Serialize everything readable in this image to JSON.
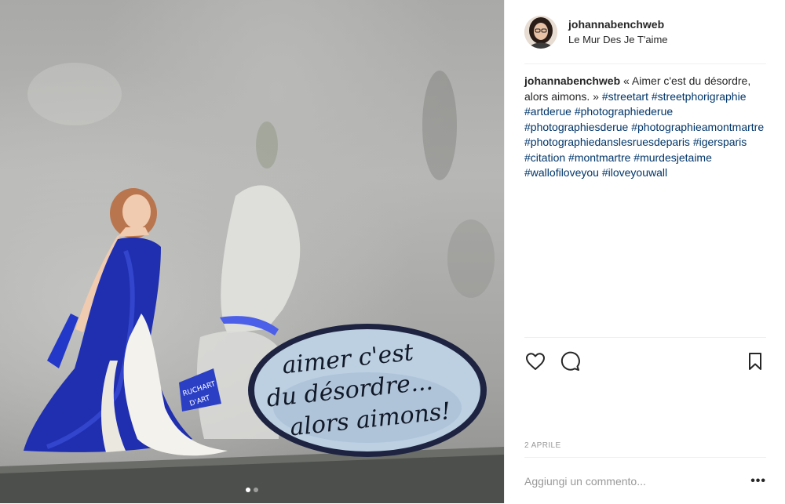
{
  "post": {
    "username": "johannabenchweb",
    "location": "Le Mur Des Je T'aime",
    "caption": {
      "username": "johannabenchweb",
      "text": "« Aimer c'est du désordre, alors aimons. »",
      "hashtags": "#streetart #streetphorigraphie #artderue #photographiederue #photographiesderue #photographieamontmartre #photographiedanslesruesdeparis #igersparis #citation #montmartre #murdesjetaime #wallofiloveyou #iloveyouwall"
    },
    "date": "2 APRILE",
    "comment_placeholder": "Aggiungi un commento...",
    "more_label": "•••"
  },
  "photo": {
    "bubble_lines": [
      "aimer c'est",
      "du désordre...",
      "alors aimons!"
    ],
    "sign_lines": [
      "RUCHART",
      "D'ART"
    ],
    "carousel": {
      "count": 2,
      "active": 1
    }
  },
  "icons": {
    "like": "heart-icon",
    "comment": "comment-icon",
    "save": "bookmark-icon"
  },
  "colors": {
    "hashtag": "#003569",
    "text": "#262626",
    "muted": "#999999",
    "divider": "#efefef",
    "dress_blue": "#1f2fb0"
  }
}
